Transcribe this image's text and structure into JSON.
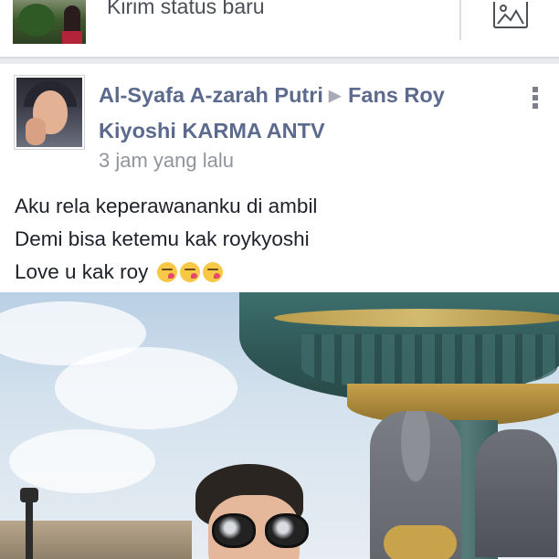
{
  "composer": {
    "placeholder": "Kirim status baru",
    "photo_icon": "photo-icon"
  },
  "post": {
    "author": "Al-Syafa A-zarah Putri",
    "separator_icon": "triangle-right-icon",
    "target_line1": "Fans Roy",
    "target_line2": "Kiyoshi KARMA ANTV",
    "timestamp": "3 jam yang lalu",
    "menu_icon": "vertical-dots-icon",
    "text_lines": [
      "Aku rela keperawananku di ambil",
      "Demi bisa ketemu kak roykyoshi",
      "Love u kak roy"
    ],
    "emojis": [
      "kissing-face-emoji",
      "kissing-face-emoji",
      "kissing-face-emoji"
    ]
  },
  "colors": {
    "author_link": "#5b6a8d",
    "timestamp": "#90949c",
    "body_text": "#1d2129",
    "divider": "#d9dadf"
  }
}
